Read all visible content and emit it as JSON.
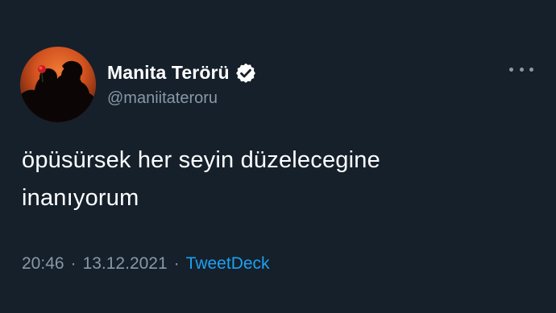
{
  "tweet": {
    "display_name": "Manita Terörü",
    "handle": "@maniitateroru",
    "text_line_1": "öpüsürsek her seyin düzelecegine",
    "text_line_2": "inanıyorum",
    "time": "20:46",
    "separator": "·",
    "date": "13.12.2021",
    "source": "TweetDeck"
  },
  "icons": {
    "verified": "verified-badge-icon",
    "more": "more-options-icon",
    "avatar": "profile-avatar"
  },
  "colors": {
    "background": "#15202b",
    "primary_text": "#ffffff",
    "secondary_text": "#8899a6",
    "link": "#1da1f2",
    "avatar_glow": "#e8622a"
  }
}
